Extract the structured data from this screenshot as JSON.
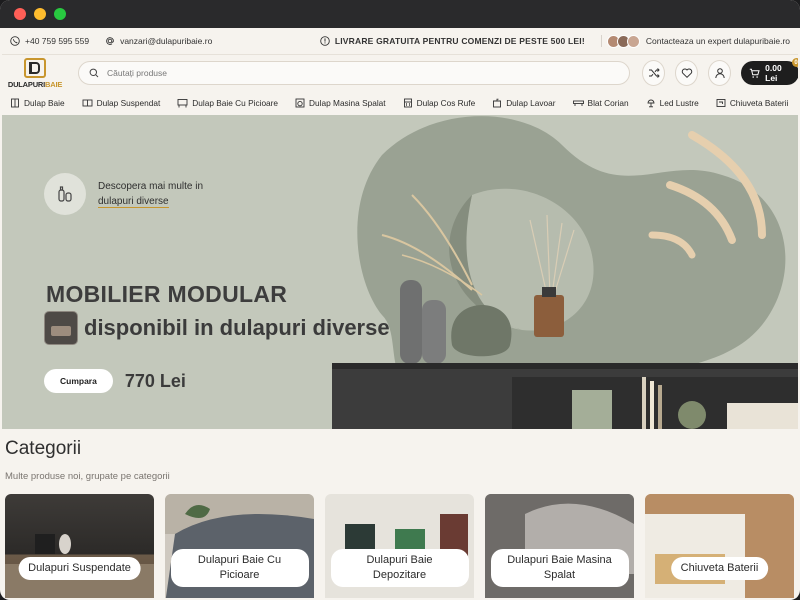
{
  "topbar": {
    "phone": "+40 759 595 559",
    "email": "vanzari@dulapuribaie.ro",
    "announcement": "LIVRARE GRATUITA PENTRU COMENZI DE PESTE 500 LEI!",
    "expert": "Contacteaza un expert dulapuribaie.ro"
  },
  "header": {
    "logo_text_a": "DULAPURI",
    "logo_text_b": "BAIE",
    "search_placeholder": "Căutați produse",
    "cart_total": "0.00 Lei",
    "cart_count": "0"
  },
  "nav": {
    "items": [
      {
        "label": "Dulap Baie",
        "icon": "cabinet-icon"
      },
      {
        "label": "Dulap Suspendat",
        "icon": "hanging-cabinet-icon"
      },
      {
        "label": "Dulap Baie Cu Picioare",
        "icon": "legged-cabinet-icon"
      },
      {
        "label": "Dulap Masina Spalat",
        "icon": "washing-machine-icon"
      },
      {
        "label": "Dulap Cos Rufe",
        "icon": "laundry-basket-icon"
      },
      {
        "label": "Dulap Lavoar",
        "icon": "sink-cabinet-icon"
      },
      {
        "label": "Blat Corian",
        "icon": "countertop-icon"
      },
      {
        "label": "Led Lustre",
        "icon": "lamp-icon"
      },
      {
        "label": "Chiuveta Baterii",
        "icon": "faucet-icon"
      }
    ]
  },
  "hero": {
    "discover_line1": "Descopera mai multe in",
    "discover_link": "dulapuri diverse",
    "title": "MOBILIER MODULAR",
    "subtitle": "disponibil in dulapuri diverse",
    "button": "Cumpara",
    "price": "770 Lei"
  },
  "categories": {
    "title": "Categorii",
    "subtitle": "Multe produse noi, grupate pe categorii",
    "items": [
      {
        "label": "Dulapuri Suspendate"
      },
      {
        "label": "Dulapuri Baie Cu Picioare"
      },
      {
        "label": "Dulapuri Baie Depozitare"
      },
      {
        "label": "Dulapuri Baie Masina Spalat"
      },
      {
        "label": "Chiuveta Baterii"
      }
    ]
  },
  "colors": {
    "accent": "#c8962e",
    "hero_bg": "#c4c9bd",
    "page_bg": "#f6f3ee",
    "cart_bg": "#1e1e1e"
  }
}
